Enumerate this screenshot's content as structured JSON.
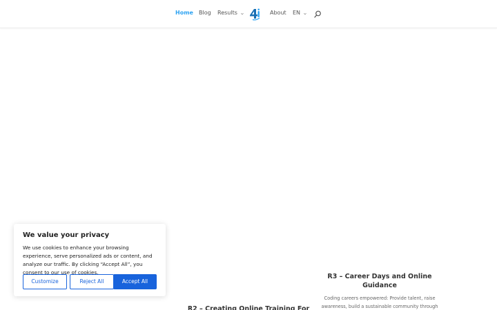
{
  "header": {
    "nav": [
      {
        "label": "Home",
        "active": true
      },
      {
        "label": "Blog"
      },
      {
        "label": "Results",
        "has_dropdown": true
      },
      {
        "label": "About"
      },
      {
        "label": "EN",
        "has_dropdown": true
      }
    ],
    "logo_icon": "4i-logo-icon",
    "search_icon": "search-icon"
  },
  "cards": {
    "r3": {
      "title_line1": "R3 – Career Days and Online",
      "title_line2": "Guidance",
      "text_line1": "Coding careers empowered: Provide talent, raise",
      "text_line2": "awareness, build a sustainable community through"
    },
    "r2": {
      "title_line1": "R2 – Creating Online Training For"
    }
  },
  "cookie": {
    "title": "We value your privacy",
    "text": "We use cookies to enhance your browsing experience, serve personalized ads or content, and analyze our traffic. By clicking “Accept All”, you consent to our use of cookies.",
    "customize_label": "Customize",
    "reject_label": "Reject All",
    "accept_label": "Accept All"
  },
  "colors": {
    "accent": "#2ea3f2",
    "cookie_button": "#1863dc"
  }
}
